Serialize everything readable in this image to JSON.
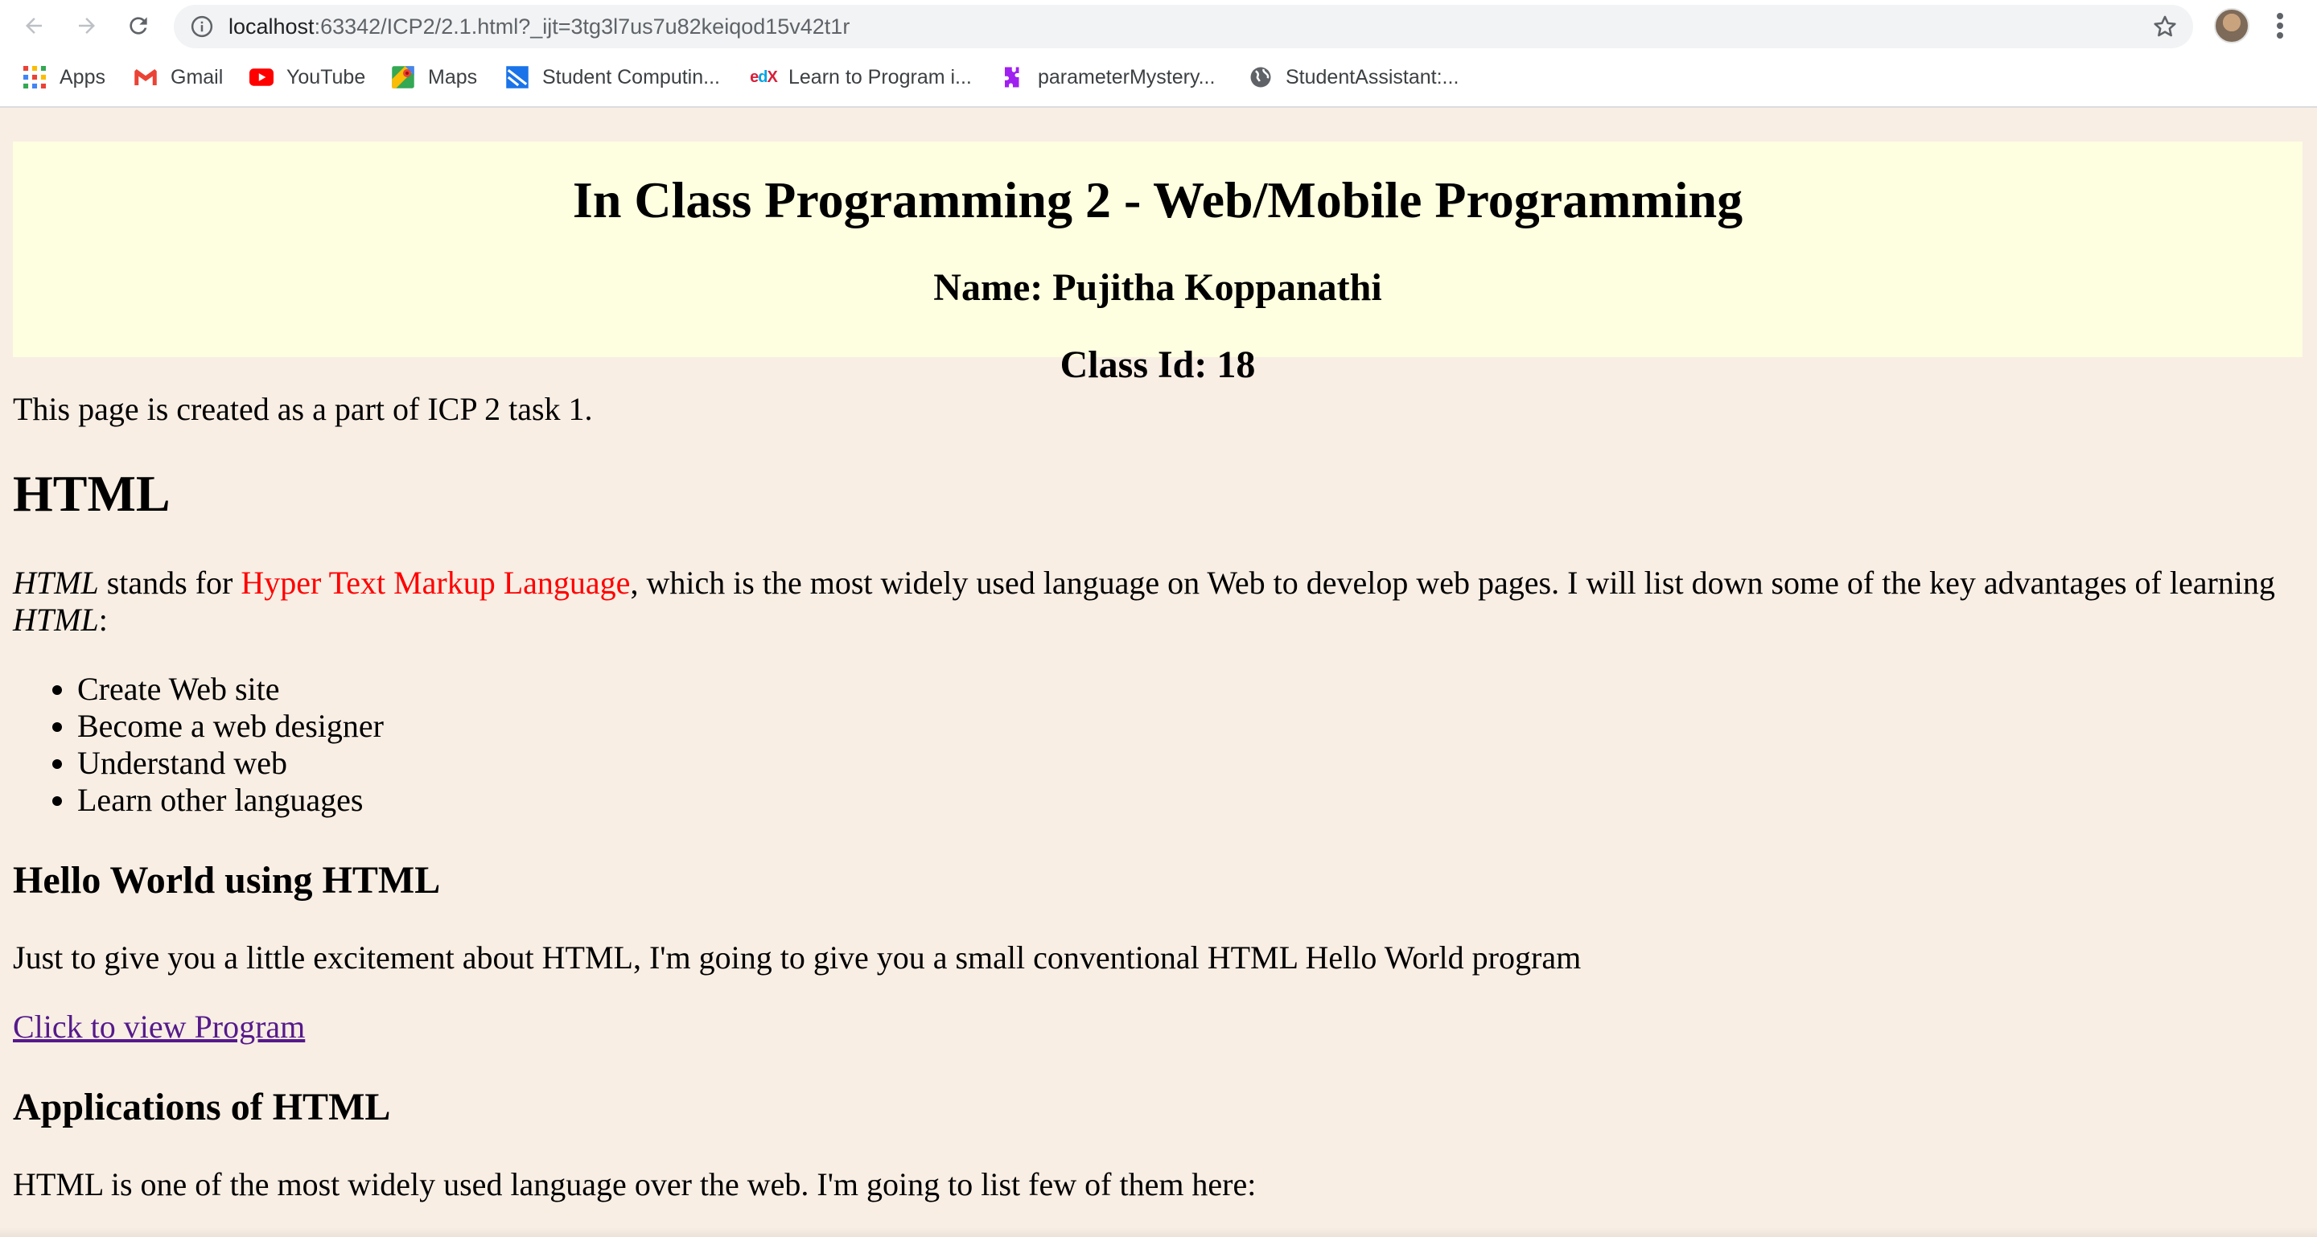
{
  "browser": {
    "url_host": "localhost",
    "url_rest": ":63342/ICP2/2.1.html?_ijt=3tg3l7us7u82keiqod15v42t1r",
    "bookmarks": [
      {
        "label": "Apps",
        "icon": "apps-grid-icon"
      },
      {
        "label": "Gmail",
        "icon": "gmail-icon"
      },
      {
        "label": "YouTube",
        "icon": "youtube-icon"
      },
      {
        "label": "Maps",
        "icon": "maps-icon"
      },
      {
        "label": "Student Computin...",
        "icon": "student-computing-icon"
      },
      {
        "label": "Learn to Program i...",
        "icon": "edx-icon"
      },
      {
        "label": "parameterMystery...",
        "icon": "puzzle-icon"
      },
      {
        "label": "StudentAssistant:...",
        "icon": "globe-icon"
      }
    ]
  },
  "header": {
    "title": "In Class Programming 2 - Web/Mobile Programming",
    "name": "Name: Pujitha Koppanathi",
    "class_id": "Class Id: 18"
  },
  "content": {
    "intro": "This page is created as a part of ICP 2 task 1.",
    "html_heading": "HTML",
    "desc_italic_1": "HTML",
    "desc_mid": " stands for ",
    "desc_red": "Hyper Text Markup Language",
    "desc_rest": ", which is the most widely used language on Web to develop web pages. I will list down some of the key advantages of learning",
    "desc_italic_2": "HTML",
    "desc_colon": ":",
    "advantages": [
      "Create Web site",
      "Become a web designer",
      "Understand web",
      "Learn other languages"
    ],
    "hello_heading": "Hello World using HTML",
    "hello_text": "Just to give you a little excitement about HTML, I'm going to give you a small conventional HTML Hello World program",
    "link_text": "Click to view Program",
    "apps_heading": "Applications of HTML",
    "apps_text": "HTML is one of the most widely used language over the web. I'm going to list few of them here:"
  },
  "colors": {
    "page_bg": "#f8eee4",
    "header_bg": "#fefee0",
    "highlight": "#ff0000",
    "link": "#551a8b"
  }
}
